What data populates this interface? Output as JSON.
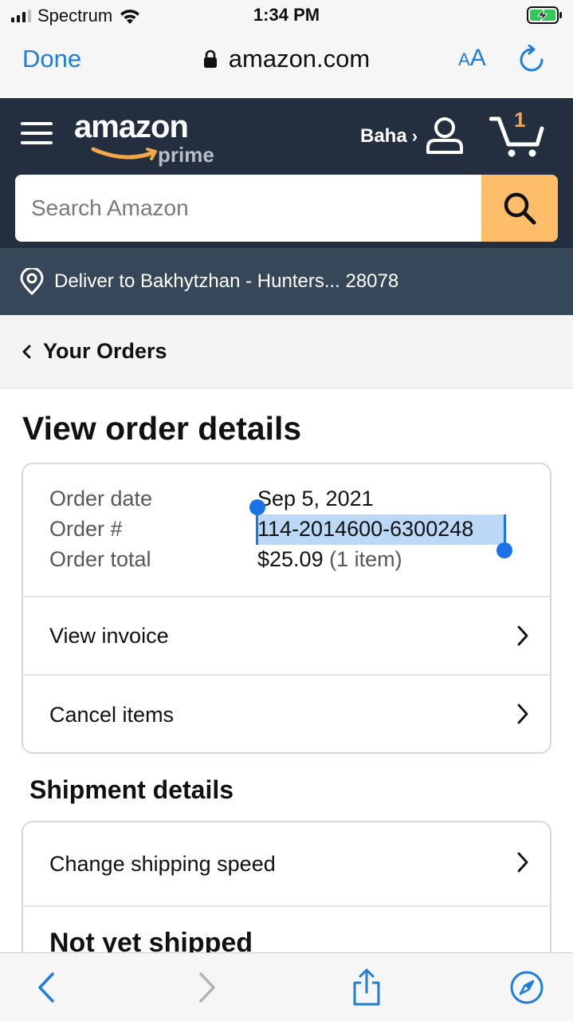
{
  "status_bar": {
    "carrier": "Spectrum",
    "time": "1:34 PM",
    "icons": [
      "cellular-signal-icon",
      "wifi-icon",
      "battery-charging-icon"
    ]
  },
  "safari": {
    "done_label": "Done",
    "url": "amazon.com",
    "aa_small": "A",
    "aa_big": "A",
    "icons": [
      "lock-icon",
      "reload-icon"
    ]
  },
  "header": {
    "logo_word": "amazon",
    "logo_prime": "prime",
    "account_name": "Baha",
    "account_chevron": "›",
    "cart_count": "1",
    "icons": [
      "menu-icon",
      "user-icon",
      "cart-icon"
    ]
  },
  "search": {
    "placeholder": "Search Amazon"
  },
  "deliver": {
    "text": "Deliver to Bakhytzhan - Hunters... 28078"
  },
  "breadcrumb": {
    "label": "Your Orders"
  },
  "page": {
    "title": "View order details"
  },
  "order": {
    "date_label": "Order date",
    "date_value": "Sep 5, 2021",
    "number_label": "Order #",
    "number_value": "114-2014600-6300248",
    "total_label": "Order total",
    "total_value": "$25.09",
    "total_items": "(1 item)",
    "actions": [
      {
        "label": "View invoice"
      },
      {
        "label": "Cancel items"
      }
    ]
  },
  "shipment": {
    "title": "Shipment details",
    "change_speed": "Change shipping speed",
    "status": "Not yet shipped"
  },
  "toolbar": {
    "icons": [
      "back-icon",
      "forward-icon",
      "share-icon",
      "compass-icon"
    ]
  },
  "colors": {
    "header_bg": "#232f3e",
    "deliver_bg": "#37475a",
    "search_button": "#febd69",
    "ios_blue": "#1f7ddb",
    "selection": "#bcd8f7",
    "cart_badge": "#f3a847"
  }
}
